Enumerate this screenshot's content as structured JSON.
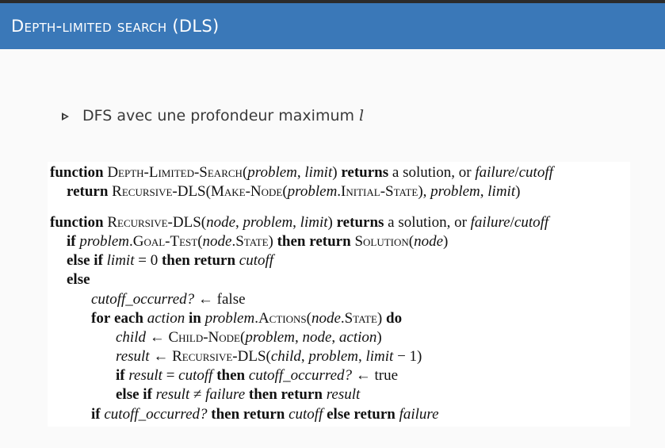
{
  "header": {
    "title": "Depth-limited search (DLS)"
  },
  "bullet": {
    "text": "DFS avec une profondeur maximum",
    "variable": "l"
  },
  "algorithm": {
    "lines": [
      "function Depth-Limited-Search(problem, limit) returns a solution, or failure/cutoff",
      "return Recursive-DLS(Make-Node(problem.Initial-State), problem, limit)",
      "function Recursive-DLS(node, problem, limit) returns a solution, or failure/cutoff",
      "if problem.Goal-Test(node.State) then return Solution(node)",
      "else if limit = 0 then return cutoff",
      "else",
      "cutoff_occurred? ← false",
      "for each action in problem.Actions(node.State) do",
      "child ← Child-Node(problem, node, action)",
      "result ← Recursive-DLS(child, problem, limit − 1)",
      "if result = cutoff then cutoff_occurred? ← true",
      "else if result ≠ failure then return result",
      "if cutoff_occurred? then return cutoff else return failure"
    ]
  }
}
